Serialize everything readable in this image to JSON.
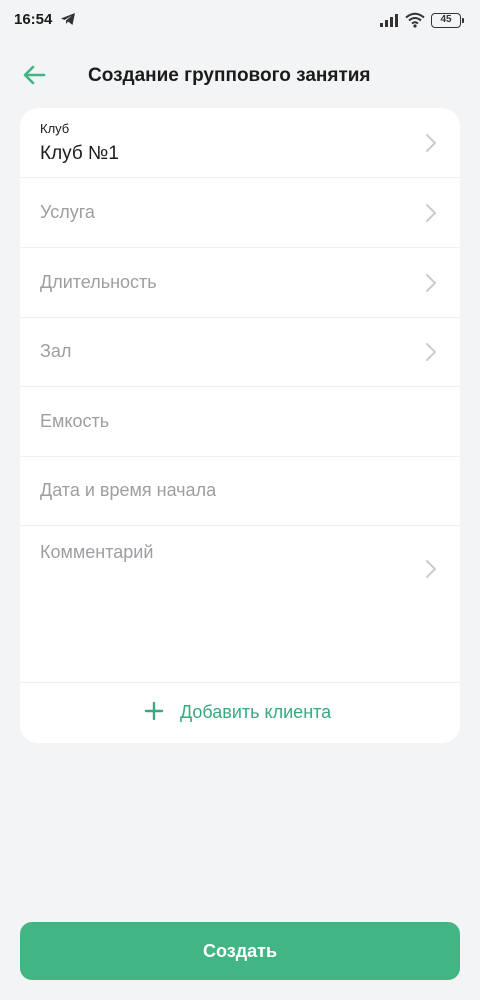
{
  "status_bar": {
    "time": "16:54",
    "battery": "45",
    "icons": [
      "telegram-icon",
      "signal-icon",
      "wifi-icon",
      "battery-icon"
    ]
  },
  "header": {
    "title": "Создание группового занятия",
    "back_icon": "arrow-left-icon"
  },
  "form": {
    "club": {
      "caption": "Клуб",
      "value": "Клуб №1"
    },
    "service": {
      "placeholder": "Услуга"
    },
    "duration": {
      "placeholder": "Длительность"
    },
    "hall": {
      "placeholder": "Зал"
    },
    "capacity": {
      "placeholder": "Емкость"
    },
    "start": {
      "placeholder": "Дата и время начала"
    },
    "comment": {
      "placeholder": "Комментарий"
    },
    "add_client": "Добавить клиента"
  },
  "footer": {
    "create_label": "Создать"
  },
  "colors": {
    "accent": "#41b584",
    "accent_text": "#3aa87f",
    "background": "#f2f4f5",
    "placeholder": "#9c9ea3"
  }
}
